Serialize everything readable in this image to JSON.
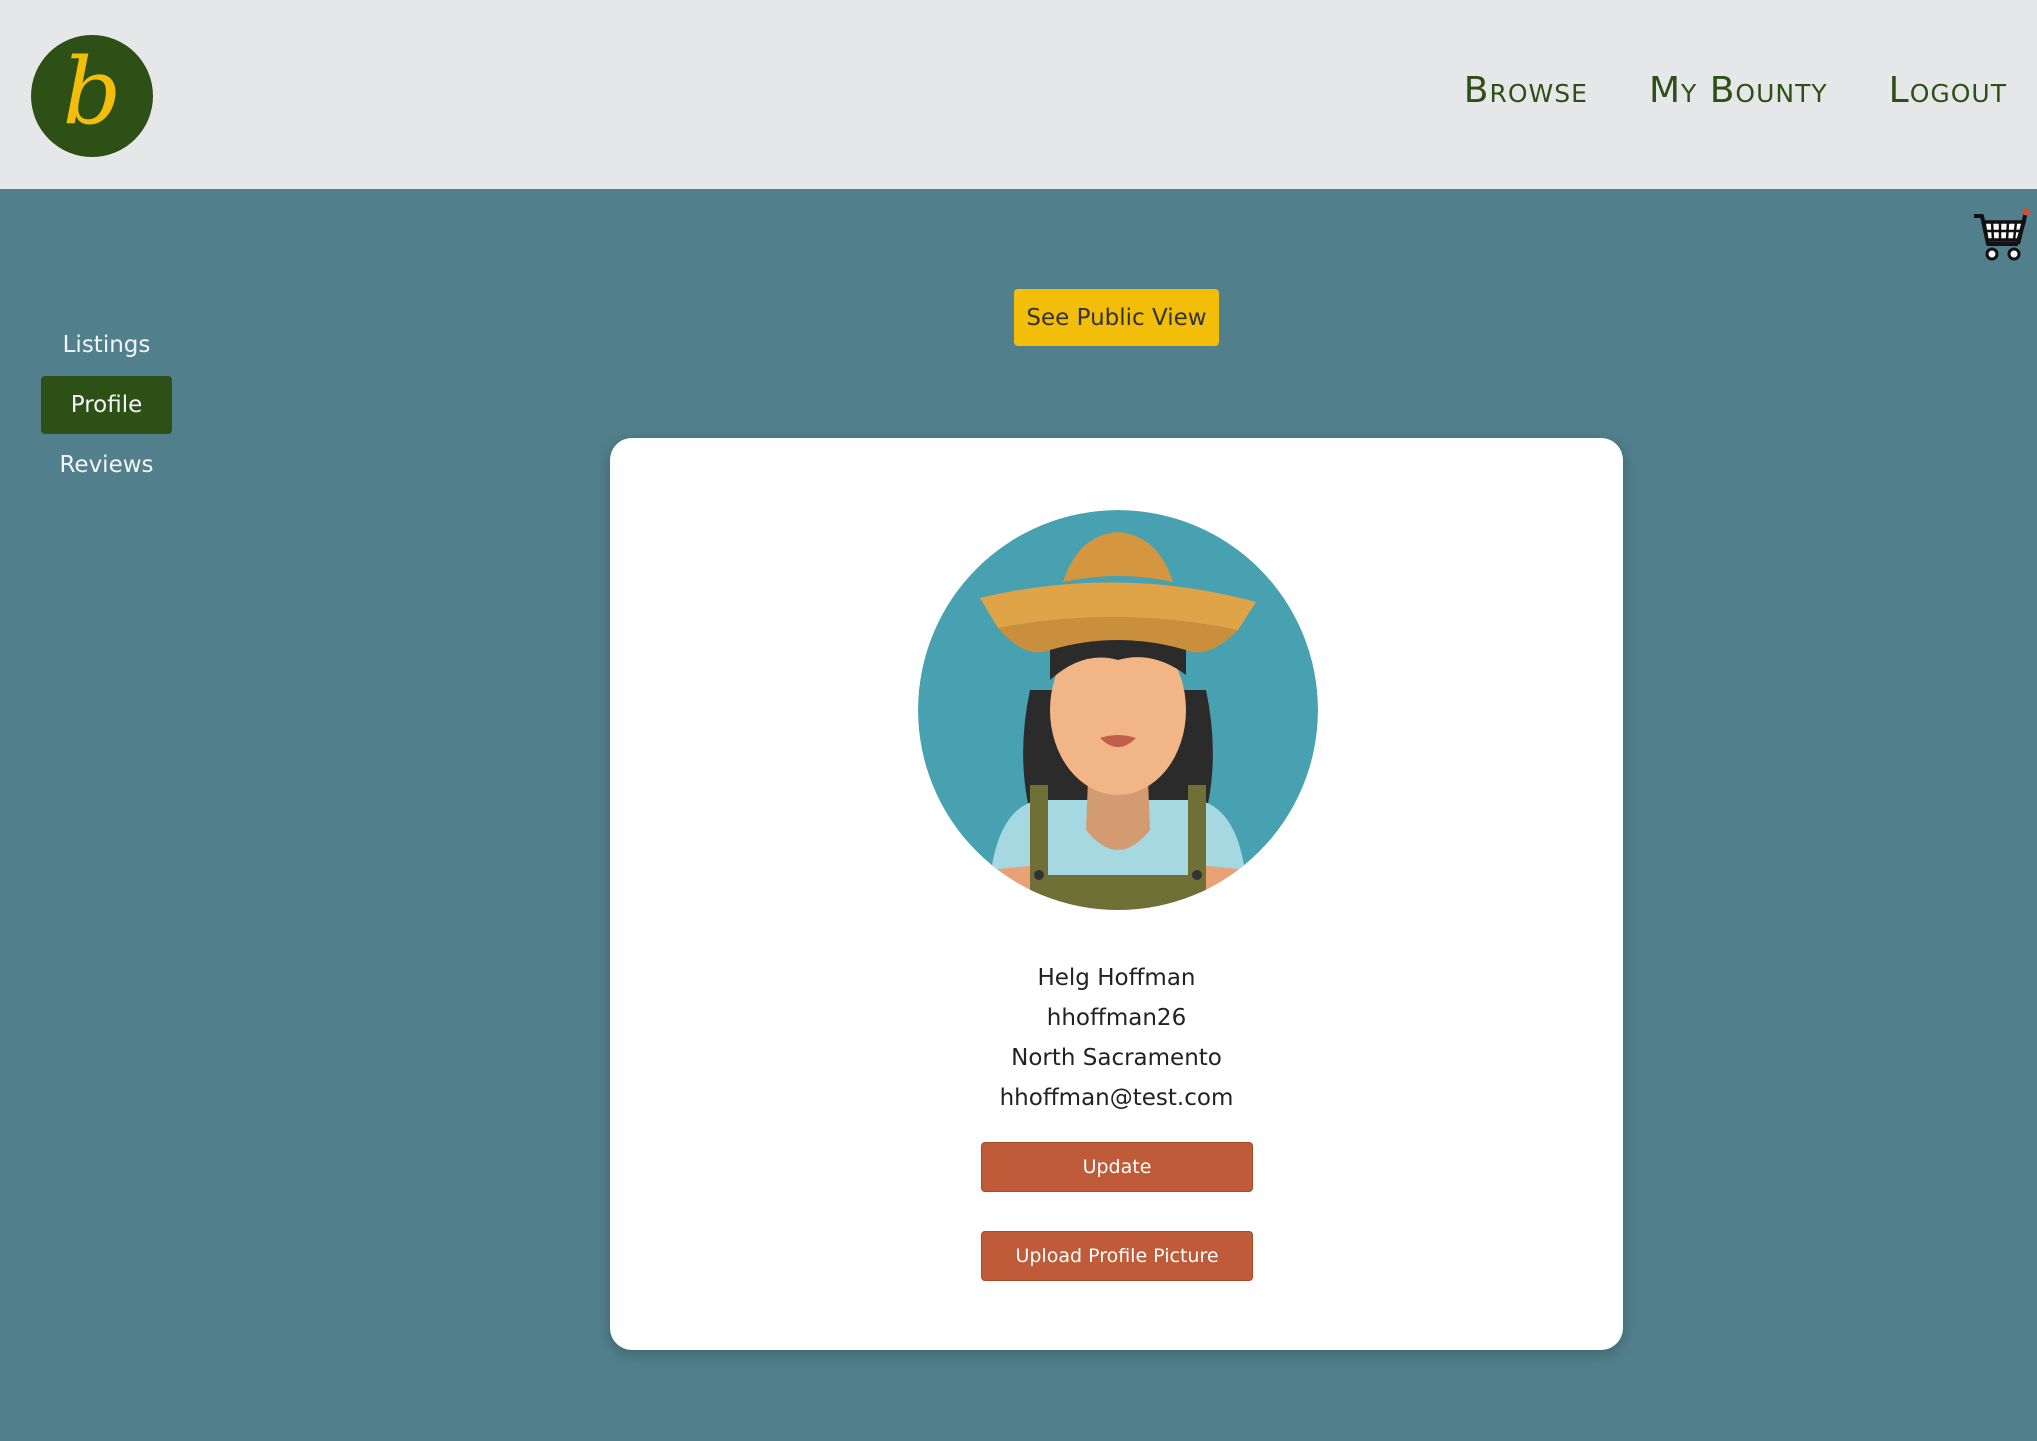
{
  "header": {
    "logo_letter": "b",
    "nav": [
      "Browse",
      "My Bounty",
      "Logout"
    ]
  },
  "sidebar": {
    "items": [
      {
        "label": "Listings",
        "active": false
      },
      {
        "label": "Profile",
        "active": true
      },
      {
        "label": "Reviews",
        "active": false
      }
    ]
  },
  "actions": {
    "public_view": "See Public View"
  },
  "profile": {
    "name": "Helg Hoffman",
    "username": "hhoffman26",
    "location": "North Sacramento",
    "email": "hhoffman@test.com",
    "update_label": "Update",
    "upload_label": "Upload Profile Picture"
  },
  "colors": {
    "background": "#517f8c",
    "header": "#e6e7e9",
    "brand_green": "#2d5016",
    "accent_yellow": "#f2be0a",
    "button_orange": "#bf5b38"
  },
  "icons": [
    "logo-icon",
    "cart-icon",
    "avatar-image"
  ]
}
